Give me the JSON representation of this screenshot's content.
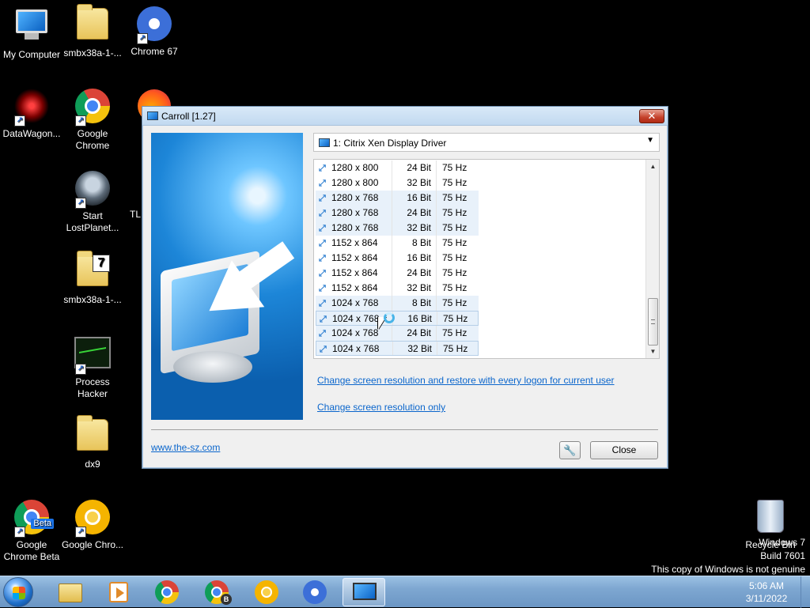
{
  "desktop": {
    "icons": [
      {
        "label": "My Computer"
      },
      {
        "label": "smbx38a-1-..."
      },
      {
        "label": "Chrome 67"
      },
      {
        "label": "DataWagon..."
      },
      {
        "label": "Google Chrome"
      },
      {
        "label": "Start LostPlanet..."
      },
      {
        "label": "TL"
      },
      {
        "label": "smbx38a-1-..."
      },
      {
        "label": "Process Hacker"
      },
      {
        "label": "dx9"
      },
      {
        "label": "Google Chrome Beta"
      },
      {
        "label": "Google Chro..."
      },
      {
        "label": "Recycle Bin"
      }
    ],
    "beta_badge": "Beta",
    "zip_badge": "7"
  },
  "watermark": {
    "line1": "Windows 7",
    "line2": "Build 7601",
    "line3": "This copy of Windows is not genuine"
  },
  "window": {
    "title": "Carroll [1.27]",
    "close_glyph": "✕",
    "driver": "1: Citrix Xen Display Driver",
    "resolutions": [
      {
        "res": "1280 x 800",
        "bits": "24 Bit",
        "hz": "75 Hz",
        "style": "plain"
      },
      {
        "res": "1280 x 800",
        "bits": "32 Bit",
        "hz": "75 Hz",
        "style": "plain"
      },
      {
        "res": "1280 x 768",
        "bits": "16 Bit",
        "hz": "75 Hz",
        "style": "tinted"
      },
      {
        "res": "1280 x 768",
        "bits": "24 Bit",
        "hz": "75 Hz",
        "style": "tinted"
      },
      {
        "res": "1280 x 768",
        "bits": "32 Bit",
        "hz": "75 Hz",
        "style": "tinted"
      },
      {
        "res": "1152 x 864",
        "bits": "8 Bit",
        "hz": "75 Hz",
        "style": "plain"
      },
      {
        "res": "1152 x 864",
        "bits": "16 Bit",
        "hz": "75 Hz",
        "style": "plain"
      },
      {
        "res": "1152 x 864",
        "bits": "24 Bit",
        "hz": "75 Hz",
        "style": "plain"
      },
      {
        "res": "1152 x 864",
        "bits": "32 Bit",
        "hz": "75 Hz",
        "style": "plain"
      },
      {
        "res": "1024 x 768",
        "bits": "8 Bit",
        "hz": "75 Hz",
        "style": "tinted"
      },
      {
        "res": "1024 x 768",
        "bits": "16 Bit",
        "hz": "75 Hz",
        "style": "boxed"
      },
      {
        "res": "1024 x 768",
        "bits": "24 Bit",
        "hz": "75 Hz",
        "style": "tinted"
      },
      {
        "res": "1024 x 768",
        "bits": "32 Bit",
        "hz": "75 Hz",
        "style": "boxed"
      }
    ],
    "link_persist": "Change screen resolution and restore with every logon for current user",
    "link_only": "Change screen resolution only",
    "website": "www.the-sz.com",
    "close_label": "Close"
  },
  "taskbar": {
    "time": "5:06 AM",
    "date": "3/11/2022",
    "chrome_beta_badge": "B",
    "items": [
      {
        "name": "windows-explorer"
      },
      {
        "name": "media-player"
      },
      {
        "name": "google-chrome"
      },
      {
        "name": "google-chrome-beta"
      },
      {
        "name": "google-chrome-canary"
      },
      {
        "name": "chrome-67"
      },
      {
        "name": "carroll"
      }
    ]
  },
  "colors": {
    "desktop_bg": "#000000",
    "link": "#0b66cc",
    "title_close": "#c4402a",
    "row_highlight": "#e8f1fa"
  }
}
